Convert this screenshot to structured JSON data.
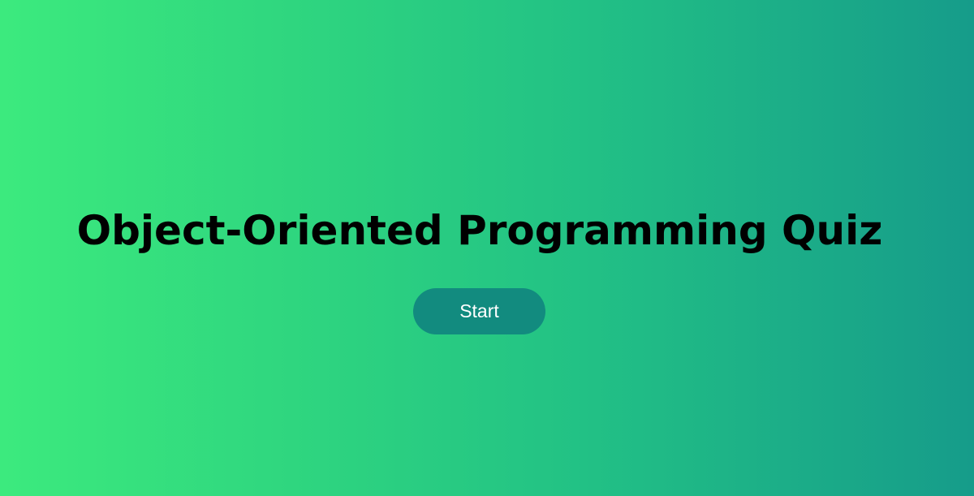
{
  "page": {
    "title": "Object-Oriented Programming Quiz"
  },
  "actions": {
    "start_label": "Start"
  },
  "colors": {
    "gradient_start": "#3cea7e",
    "gradient_end": "#169c8a",
    "button_bg": "#128b7f",
    "title_text": "#000000",
    "button_text": "#ffffff"
  }
}
